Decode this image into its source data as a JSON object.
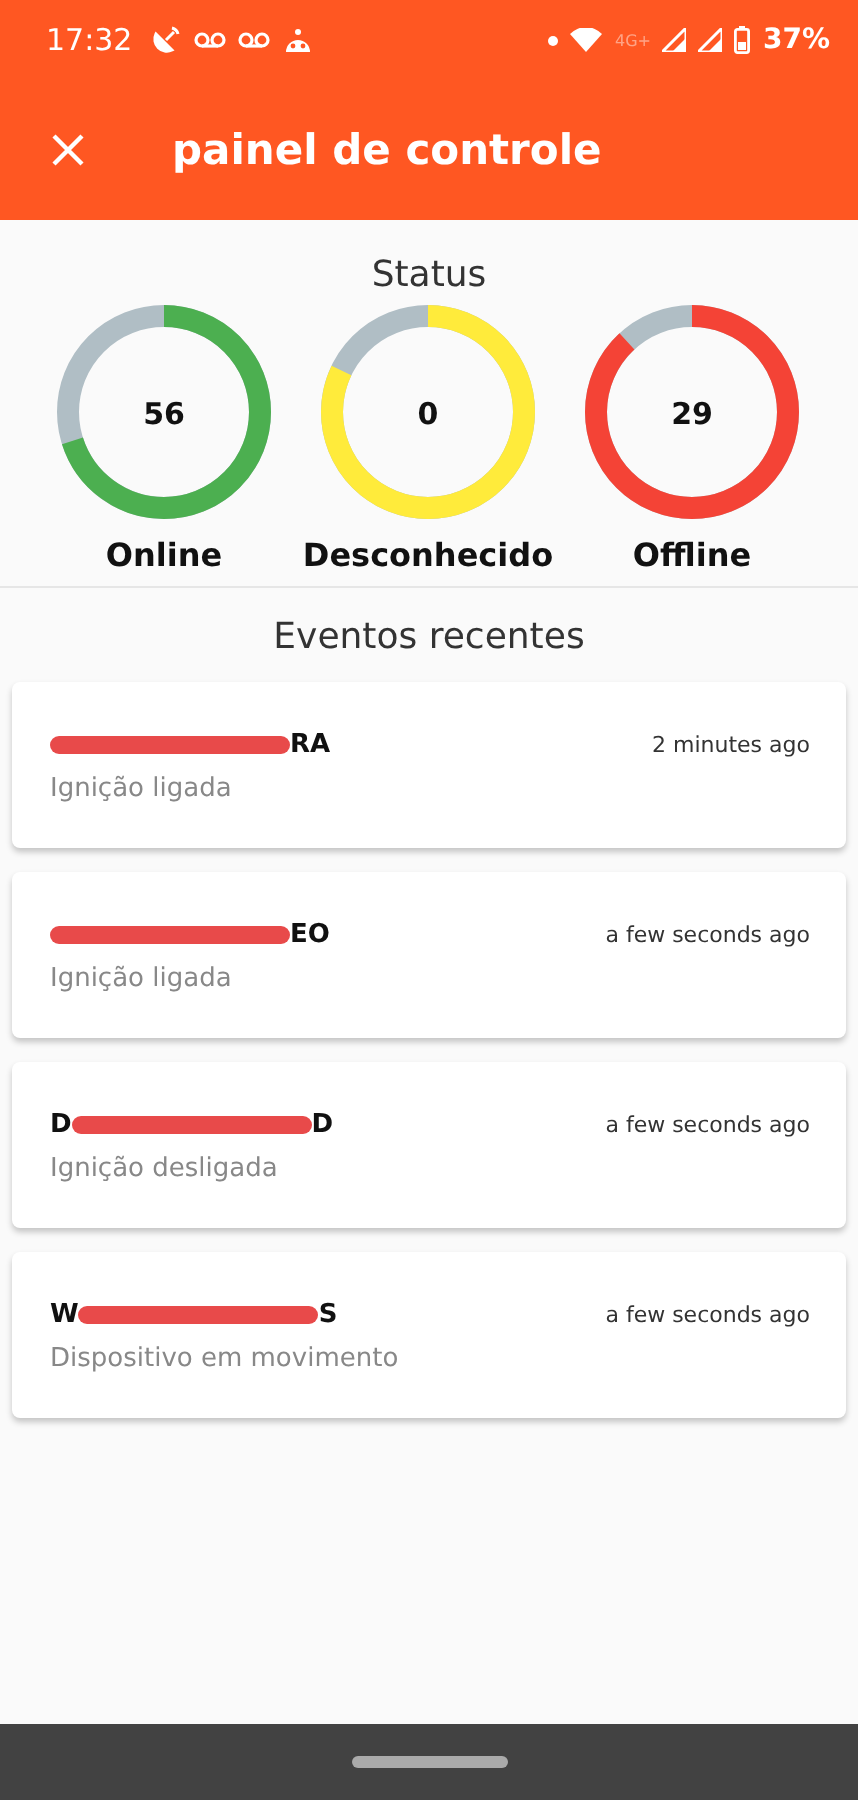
{
  "status_bar": {
    "time": "17:32",
    "network": "4G+",
    "battery": "37%"
  },
  "app_bar": {
    "title": "painel de controle"
  },
  "status": {
    "title": "Status",
    "gauges": [
      {
        "label": "Online",
        "count": "56",
        "level": 0.7,
        "color": "#4caf50"
      },
      {
        "label": "Desconhecido",
        "count": "0",
        "level": 0.82,
        "color": "#ffeb3b"
      },
      {
        "label": "Offline",
        "count": "29",
        "level": 0.88,
        "color": "#f44336"
      }
    ]
  },
  "events": {
    "title": "Eventos recentes",
    "items": [
      {
        "name_end": "RA",
        "time": "2 minutes ago",
        "event": "Ignição ligada"
      },
      {
        "name_end": "EO",
        "time": "a few seconds ago",
        "event": "Ignição ligada"
      },
      {
        "name_start": "D",
        "name_end": "D",
        "time": "a few seconds ago",
        "event": "Ignição desligada"
      },
      {
        "name_start": "W",
        "name_end": "S",
        "time": "a few seconds ago",
        "event": "Dispositivo em movimento"
      }
    ]
  }
}
